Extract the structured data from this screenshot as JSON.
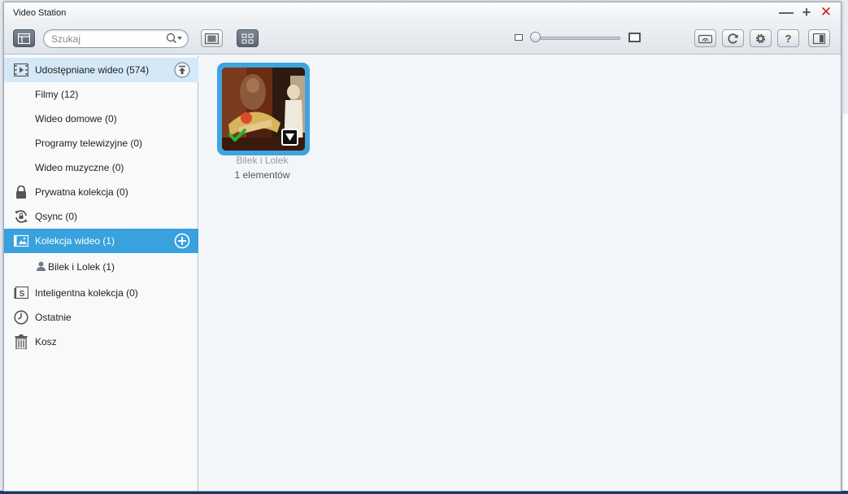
{
  "window": {
    "title": "Video Station"
  },
  "toolbar": {
    "search_placeholder": "Szukaj"
  },
  "sidebar": {
    "items": [
      {
        "label": "Udostępniane wideo (574)"
      },
      {
        "label": "Filmy (12)"
      },
      {
        "label": "Wideo domowe (0)"
      },
      {
        "label": "Programy telewizyjne (0)"
      },
      {
        "label": "Wideo muzyczne (0)"
      },
      {
        "label": "Prywatna kolekcja (0)"
      },
      {
        "label": "Qsync (0)"
      },
      {
        "label": "Kolekcja wideo (1)"
      },
      {
        "label": "Bilek i Lolek (1)"
      },
      {
        "label": "Inteligentna kolekcja (0)"
      },
      {
        "label": "Ostatnie"
      },
      {
        "label": "Kosz"
      }
    ]
  },
  "content": {
    "collections": [
      {
        "title": "Bilek i Lolek",
        "count": "1 elementów"
      }
    ]
  },
  "colors": {
    "accent": "#38a1de",
    "highlight": "#d5e8f7",
    "close": "#d51b1b",
    "check": "#2bb12e"
  }
}
